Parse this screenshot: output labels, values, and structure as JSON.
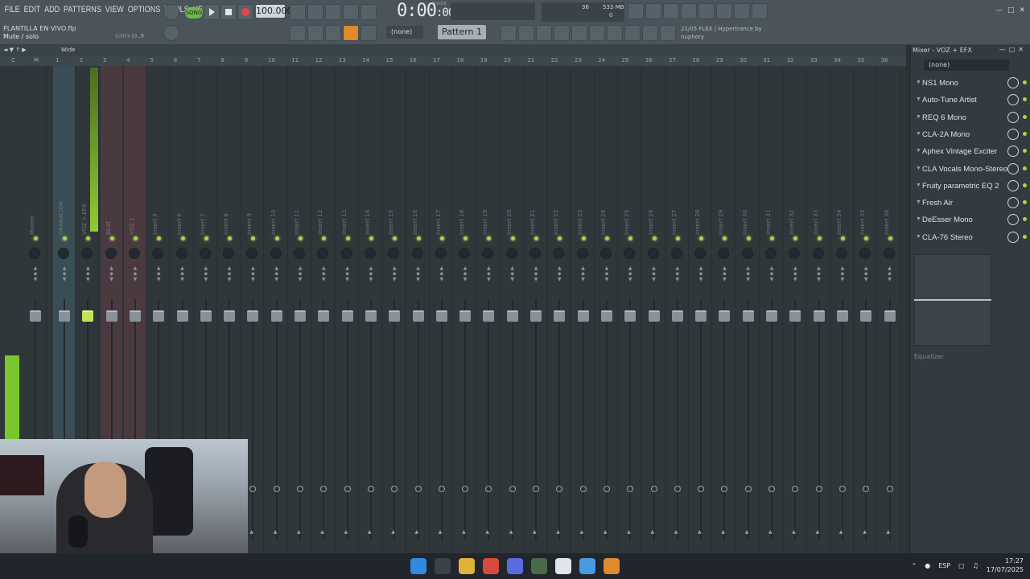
{
  "menu": [
    "FILE",
    "EDIT",
    "ADD",
    "PATTERNS",
    "VIEW",
    "OPTIONS",
    "TOOLS",
    "HELP"
  ],
  "transport": {
    "mode": "SONG",
    "bpm": "100.000",
    "time": "0:00",
    "time_small": ":00",
    "time_unit": "M:S:CS"
  },
  "cpu": {
    "a": "36",
    "b": "533 MB",
    "c": "0"
  },
  "file": {
    "name": "PLANTILLA EN VIVO.flp",
    "hint": "Mute / solo",
    "shortcut": "(ctrl+)0..9"
  },
  "pattern": {
    "none_label": "(none)",
    "name": "Pattern 1"
  },
  "plugin_info": {
    "line1": "21/05  FLEX | Hypertrance by",
    "line2": "nuphory"
  },
  "mixer_head": {
    "preset": "Wide",
    "ruler_labels": [
      "C",
      "M",
      "1",
      "2",
      "3",
      "4",
      "5",
      "6",
      "7",
      "8",
      "9",
      "10",
      "11",
      "12",
      "13",
      "14",
      "15",
      "16",
      "17",
      "18",
      "19",
      "20",
      "21",
      "22",
      "23",
      "24",
      "25",
      "26",
      "27",
      "28",
      "29",
      "30",
      "31",
      "32",
      "33",
      "34",
      "35",
      "36"
    ]
  },
  "strips": [
    "Master",
    "GRABACION",
    "VOZ + EFX",
    "BEAT",
    "VOZ 1",
    "Insert 5",
    "Insert 6",
    "Insert 7",
    "Insert 8",
    "Insert 9",
    "Insert 10",
    "Insert 11",
    "Insert 12",
    "Insert 13",
    "Insert 14",
    "Insert 15",
    "Insert 16",
    "Insert 17",
    "Insert 18",
    "Insert 19",
    "Insert 20",
    "Insert 21",
    "Insert 22",
    "Insert 23",
    "Insert 24",
    "Insert 25",
    "Insert 26",
    "Insert 27",
    "Insert 28",
    "Insert 29",
    "Insert 30",
    "Insert 31",
    "Insert 32",
    "Insert 33",
    "Insert 34",
    "Insert 35",
    "Insert 36"
  ],
  "panel": {
    "title": "Mixer - VOZ + EFX",
    "preset": "(none)",
    "slots": [
      "NS1 Mono",
      "Auto-Tune Artist",
      "REQ 6 Mono",
      "CLA-2A Mono",
      "Aphex Vintage Exciter",
      "CLA Vocals Mono-Stereo",
      "Fruity parametric EQ 2",
      "Fresh Air",
      "DeEsser Mono",
      "CLA-76 Stereo"
    ],
    "eq_label": "Equalizer"
  },
  "taskbar": {
    "lang": "ESP",
    "time": "17:27",
    "date": "17/07/2025"
  },
  "colors": {
    "accent_green": "#a7d64a",
    "selected_strip": "#3a4d55",
    "song_pill": "#6cb84a"
  }
}
